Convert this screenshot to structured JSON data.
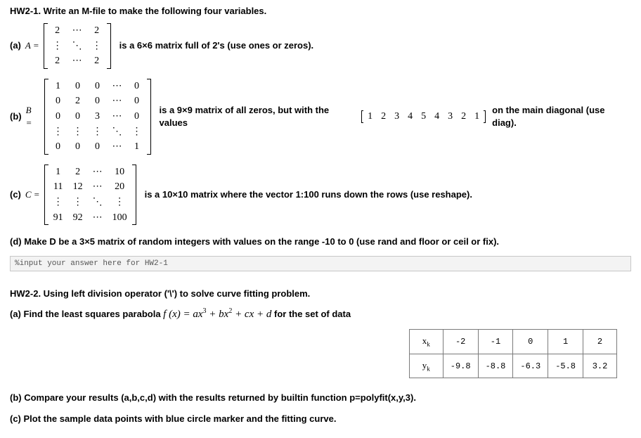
{
  "q1": {
    "title": "HW2-1. Write an M-file to make the following four variables.",
    "a": {
      "label": "(a)",
      "var": "A =",
      "desc": "is a 6×6 matrix full of 2's (use ones or zeros).",
      "m": [
        [
          "2",
          "⋯",
          "2"
        ],
        [
          "⋮",
          "⋱",
          "⋮"
        ],
        [
          "2",
          "⋯",
          "2"
        ]
      ]
    },
    "b": {
      "label": "(b)",
      "var": "B =",
      "desc_pre": "is a 9×9 matrix of all zeros, but with the values",
      "desc_post": "on the main diagonal (use diag).",
      "m": [
        [
          "1",
          "0",
          "0",
          "⋯",
          "0"
        ],
        [
          "0",
          "2",
          "0",
          "⋯",
          "0"
        ],
        [
          "0",
          "0",
          "3",
          "⋯",
          "0"
        ],
        [
          "⋮",
          "⋮",
          "⋮",
          "⋱",
          "⋮"
        ],
        [
          "0",
          "0",
          "0",
          "⋯",
          "1"
        ]
      ],
      "diag": [
        "1",
        "2",
        "3",
        "4",
        "5",
        "4",
        "3",
        "2",
        "1"
      ]
    },
    "c": {
      "label": "(c)",
      "var": "C =",
      "desc": "is a 10×10 matrix where the vector 1:100 runs down the rows (use reshape).",
      "m": [
        [
          "1",
          "2",
          "⋯",
          "10"
        ],
        [
          "11",
          "12",
          "⋯",
          "20"
        ],
        [
          "⋮",
          "⋮",
          "⋱",
          "⋮"
        ],
        [
          "91",
          "92",
          "⋯",
          "100"
        ]
      ]
    },
    "d": {
      "text": "(d)  Make D be a 3×5 matrix of random integers with values on the range -10 to 0 (use rand and floor or ceil or fix)."
    },
    "input_placeholder": "%input your answer here for HW2-1"
  },
  "q2": {
    "title": "HW2-2. Using left division operator ('\\') to solve curve fitting problem.",
    "a_pre": "(a) Find the least squares parabola ",
    "a_formula": "f(x) = ax³ + bx² + cx + d",
    "a_post": " for the set of data",
    "b": "(b) Compare your results (a,b,c,d) with the results returned by builtin function p=polyfit(x,y,3).",
    "c": "(c) Plot the sample data points with blue circle marker and the fitting curve."
  },
  "chart_data": {
    "type": "table",
    "title": "Sample data for least-squares cubic fit",
    "rows": [
      {
        "label": "xₖ",
        "values": [
          -2,
          -1,
          0,
          1,
          2
        ]
      },
      {
        "label": "yₖ",
        "values": [
          -9.8,
          -8.8,
          -6.3,
          -5.8,
          3.2
        ]
      }
    ]
  }
}
